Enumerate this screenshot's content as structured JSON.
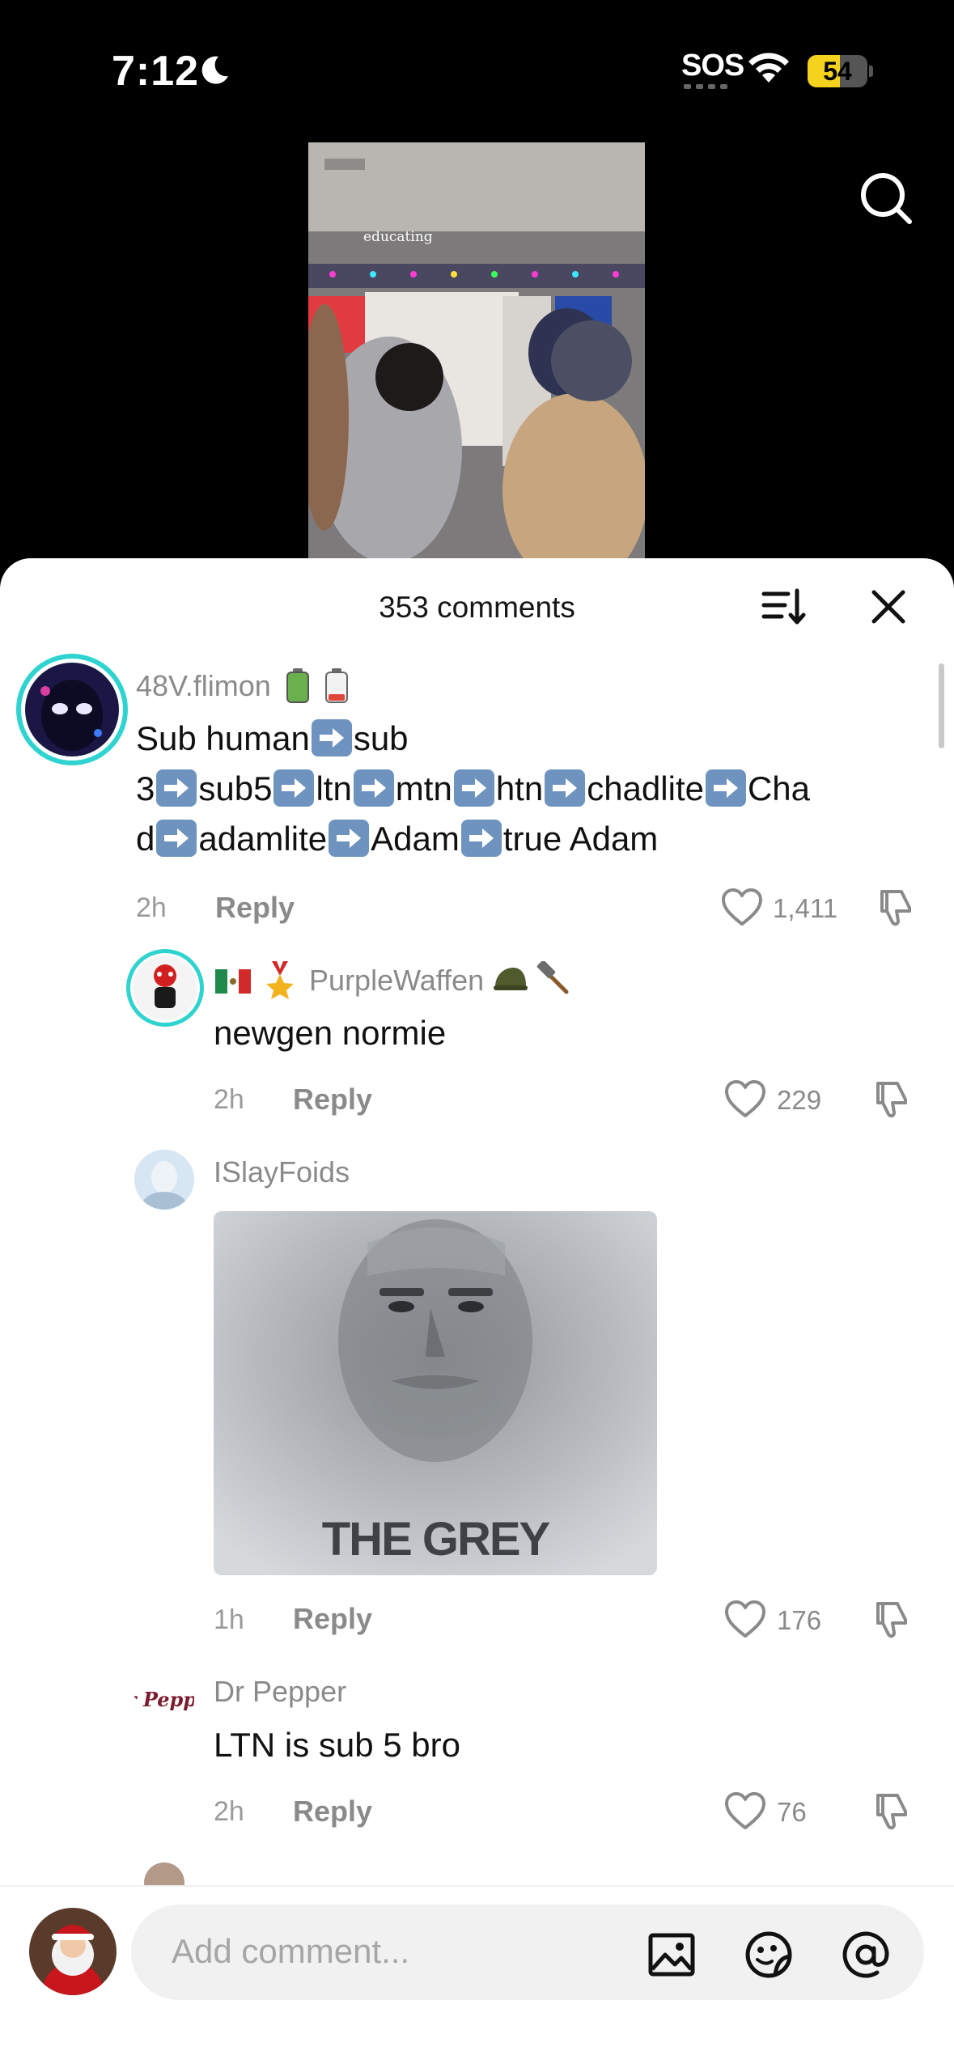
{
  "status_bar": {
    "time": "7:12",
    "sos": "SOS",
    "battery_level": 54,
    "battery_text": "54"
  },
  "video": {
    "caption": "educating"
  },
  "comments_header": {
    "title": "353 comments"
  },
  "comments": [
    {
      "username": "48V.flimon",
      "text_parts": [
        "Sub human",
        "sub 3",
        "sub5",
        "ltn",
        "mtn",
        "htn",
        "chadlite",
        "Chad",
        "adamlite",
        "Adam",
        "true Adam"
      ],
      "time": "2h",
      "reply_label": "Reply",
      "likes": "1,411"
    },
    {
      "username": "PurpleWaffen",
      "text": "newgen normie",
      "time": "2h",
      "reply_label": "Reply",
      "likes": "229"
    },
    {
      "username": "ISlayFoids",
      "image_caption": "THE GREY",
      "time": "1h",
      "reply_label": "Reply",
      "likes": "176"
    },
    {
      "username": "Dr Pepper",
      "avatar_text": "Dr Pepper",
      "text": "LTN is sub 5 bro",
      "time": "2h",
      "reply_label": "Reply",
      "likes": "76"
    }
  ],
  "input": {
    "placeholder": "Add comment..."
  },
  "icons": {
    "search": "search-icon",
    "sort": "sort-icon",
    "close": "close-icon",
    "like": "heart-icon",
    "dislike": "thumbs-down-icon",
    "image": "image-icon",
    "sticker": "sticker-icon",
    "mention": "at-icon"
  }
}
